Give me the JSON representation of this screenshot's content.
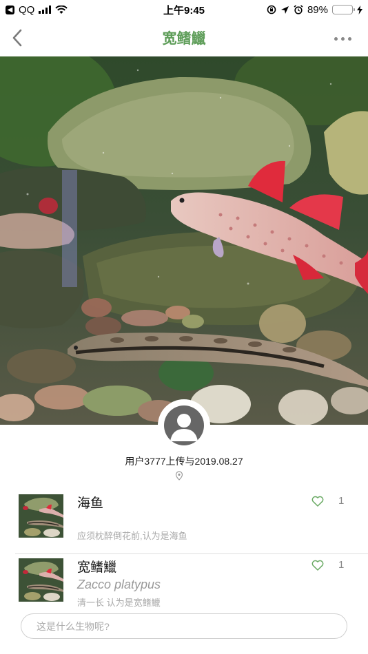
{
  "status_bar": {
    "carrier": "QQ",
    "time": "上午9:45",
    "battery_percent": "89%",
    "battery_level": 0.89
  },
  "nav": {
    "title": "宽鳍鱲",
    "back_icon": "chevron-left-icon",
    "more_icon": "more-dots-icon"
  },
  "post": {
    "uploader_text": "用户3777上传与2019.08.27",
    "location_icon": "location-pin-icon"
  },
  "identifications": [
    {
      "name": "海鱼",
      "scientific_name": "",
      "note": "应须枕醉倒花前,认为是海鱼",
      "likes": "1"
    },
    {
      "name": "宽鳍鱲",
      "scientific_name": "Zacco platypus",
      "note": "清一长 认为是宽鳍鱲",
      "likes": "1"
    }
  ],
  "bottom": {
    "placeholder": "这是什么生物呢?"
  },
  "colors": {
    "accent": "#5f9e5a",
    "heart": "#6aaa64"
  }
}
